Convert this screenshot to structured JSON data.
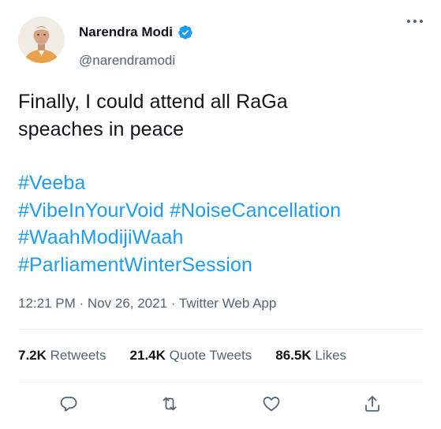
{
  "author": {
    "display_name": "Narendra Modi",
    "handle": "@narendramodi",
    "verified": true
  },
  "tweet": {
    "text_lines": [
      "Finally, I could attend all RaGa",
      "speaches in peace"
    ],
    "hashtag_lines": [
      [
        "#Veeba"
      ],
      [
        "#VibeInYourVoid",
        "#NoiseCancellation"
      ],
      [
        "#WaahModijiWaah"
      ],
      [
        "#ParliamentWinterSession"
      ]
    ]
  },
  "meta": {
    "time": "12:21 PM",
    "separator": "·",
    "date": "Nov 26, 2021",
    "source": "Twitter Web App"
  },
  "stats": {
    "retweets_count": "7.2K",
    "retweets_label": "Retweets",
    "quotes_count": "21.4K",
    "quotes_label": "Quote Tweets",
    "likes_count": "86.5K",
    "likes_label": "Likes"
  },
  "icons": {
    "more": "more-icon",
    "verified": "verified-badge-icon",
    "reply": "reply-icon",
    "retweet": "retweet-icon",
    "like": "like-icon",
    "share": "share-icon"
  },
  "colors": {
    "accent": "#1d9bf0",
    "text": "#0f1419",
    "secondary": "#536471",
    "divider": "#eff3f4"
  }
}
